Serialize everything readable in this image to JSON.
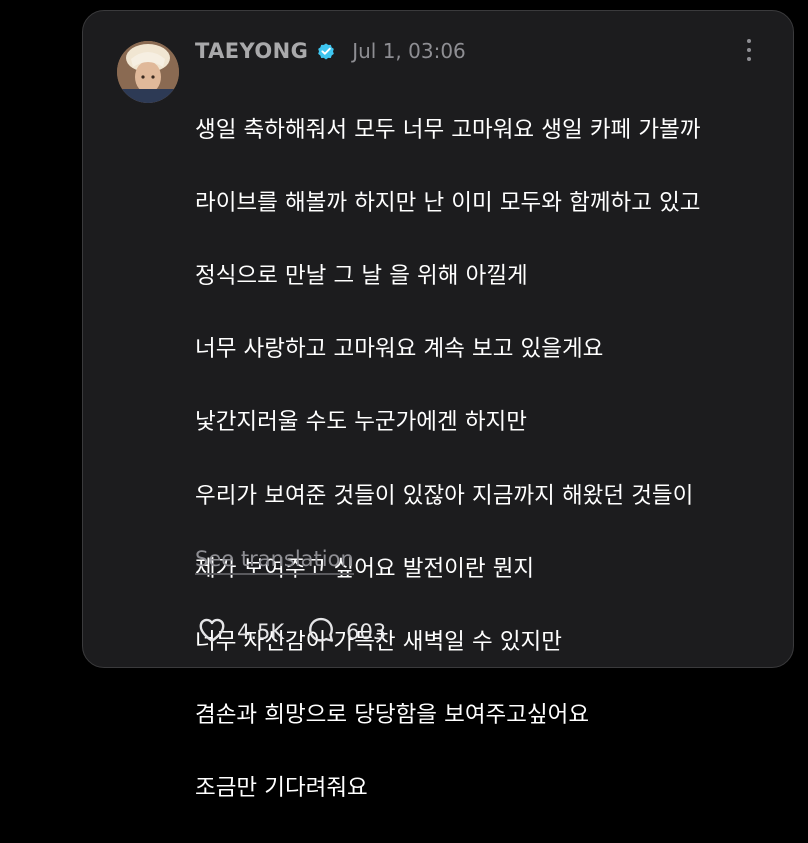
{
  "post": {
    "username": "TAEYONG",
    "verified_icon": "verified-badge-icon",
    "timestamp": "Jul 1, 03:06",
    "more_icon": "more-vertical-icon",
    "lines": [
      "생일 축하해줘서 모두 너무 고마워요 생일 카페 가볼까",
      "라이브를 해볼까 하지만 난 이미 모두와 함께하고 있고",
      "정식으로 만날 그 날 을 위해 아낄게",
      "너무 사랑하고 고마워요 계속 보고 있을게요",
      "낯간지러울 수도 누군가에겐 하지만",
      "우리가 보여준 것들이 있잖아 지금까지 해왔던 것들이",
      "제가 보여주고 싶어요 발전이란 뭔지",
      "너무 자신감이 가득찬 새벽일 수 있지만",
      "겸손과 희망으로 당당함을 보여주고싶어요",
      "조금만 기다려줘요"
    ],
    "see_translation": "See translation",
    "likes": "4.5K",
    "comments": "603"
  },
  "colors": {
    "background": "#000000",
    "card": "#1c1c1e",
    "verified": "#3ec6f0",
    "muted": "#8e8e93"
  }
}
